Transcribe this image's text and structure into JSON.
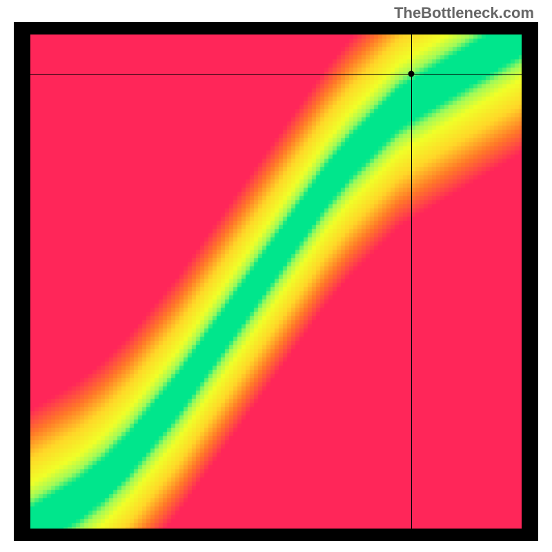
{
  "watermark": "TheBottleneck.com",
  "chart_data": {
    "type": "heatmap",
    "title": "",
    "xlabel": "",
    "ylabel": "",
    "xlim": [
      0,
      100
    ],
    "ylim": [
      0,
      100
    ],
    "marker": {
      "x_pct": 77.5,
      "y_from_top_pct": 8.0
    },
    "ridge_points": [
      {
        "x": 0,
        "y": 0
      },
      {
        "x": 5,
        "y": 3
      },
      {
        "x": 10,
        "y": 6
      },
      {
        "x": 15,
        "y": 10
      },
      {
        "x": 20,
        "y": 15
      },
      {
        "x": 25,
        "y": 21
      },
      {
        "x": 30,
        "y": 27
      },
      {
        "x": 35,
        "y": 34
      },
      {
        "x": 40,
        "y": 41
      },
      {
        "x": 45,
        "y": 48
      },
      {
        "x": 50,
        "y": 55
      },
      {
        "x": 55,
        "y": 62
      },
      {
        "x": 60,
        "y": 69
      },
      {
        "x": 65,
        "y": 75
      },
      {
        "x": 70,
        "y": 80
      },
      {
        "x": 75,
        "y": 85
      },
      {
        "x": 80,
        "y": 88
      },
      {
        "x": 85,
        "y": 91
      },
      {
        "x": 90,
        "y": 94
      },
      {
        "x": 95,
        "y": 97
      },
      {
        "x": 100,
        "y": 100
      }
    ],
    "band_width_pct": 4.0,
    "softness_pct": 20.0,
    "colormap": [
      {
        "t": 0.0,
        "r": 255,
        "g": 38,
        "b": 89
      },
      {
        "t": 0.25,
        "r": 255,
        "g": 120,
        "b": 40
      },
      {
        "t": 0.5,
        "r": 255,
        "g": 215,
        "b": 40
      },
      {
        "t": 0.75,
        "r": 240,
        "g": 255,
        "b": 40
      },
      {
        "t": 0.9,
        "r": 160,
        "g": 250,
        "b": 90
      },
      {
        "t": 1.0,
        "r": 0,
        "g": 230,
        "b": 140
      }
    ]
  }
}
